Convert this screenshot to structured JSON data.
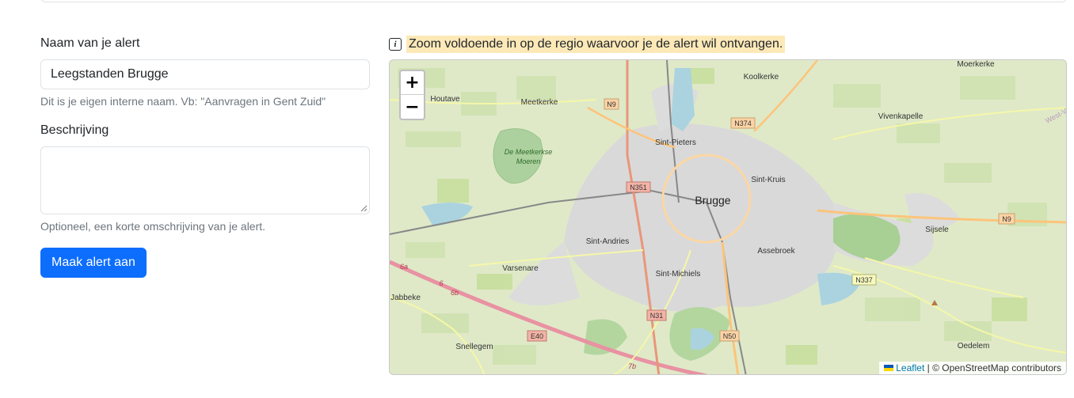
{
  "form": {
    "name_label": "Naam van je alert",
    "name_value": "Leegstanden Brugge",
    "name_help": "Dit is je eigen interne naam. Vb: \"Aanvragen in Gent Zuid\"",
    "desc_label": "Beschrijving",
    "desc_value": "",
    "desc_help": "Optioneel, een korte omschrijving van je alert.",
    "submit_label": "Maak alert aan"
  },
  "notice": {
    "icon": "info-icon",
    "icon_glyph": "i",
    "text": "Zoom voldoende in op de regio waarvoor je de alert wil ontvangen."
  },
  "map": {
    "zoom_in": "+",
    "zoom_out": "−",
    "attribution_link": "Leaflet",
    "attribution_rest": "| © OpenStreetMap contributors",
    "places": {
      "moerkerke": "Moerkerke",
      "koolkerke": "Koolkerke",
      "houtave": "Houtave",
      "meetkerke": "Meetkerke",
      "vivenkapelle": "Vivenkapelle",
      "meetkerkse_moeren_1": "De Meetkerkse",
      "meetkerkse_moeren_2": "Moeren",
      "sint_pieters": "Sint-Pieters",
      "sint_kruis": "Sint-Kruis",
      "brugge": "Brugge",
      "sijsele": "Sijsele",
      "sint_andries": "Sint-Andries",
      "assebroek": "Assebroek",
      "varsenare": "Varsenare",
      "sint_michiels": "Sint-Michiels",
      "jabbeke": "Jabbeke",
      "snellegem": "Snellegem",
      "oedelem": "Oedelem",
      "west_vlaanderen": "West-Vlaan"
    },
    "roads": {
      "n9_west": "N9",
      "n374": "N374",
      "n351": "N351",
      "n9_east": "N9",
      "n337": "N337",
      "n31": "N31",
      "e40": "E40",
      "n50": "N50",
      "r6a": "6a",
      "r6": "6",
      "r6b": "6b",
      "r7b": "7b"
    },
    "colors": {
      "land": "#dfe9c8",
      "urban": "#d9d9d9",
      "forest": "#add19e",
      "motorway": "#e892a2",
      "primary": "#fcd6a4",
      "secondary": "#f7fabf",
      "water": "#aad3df"
    }
  }
}
